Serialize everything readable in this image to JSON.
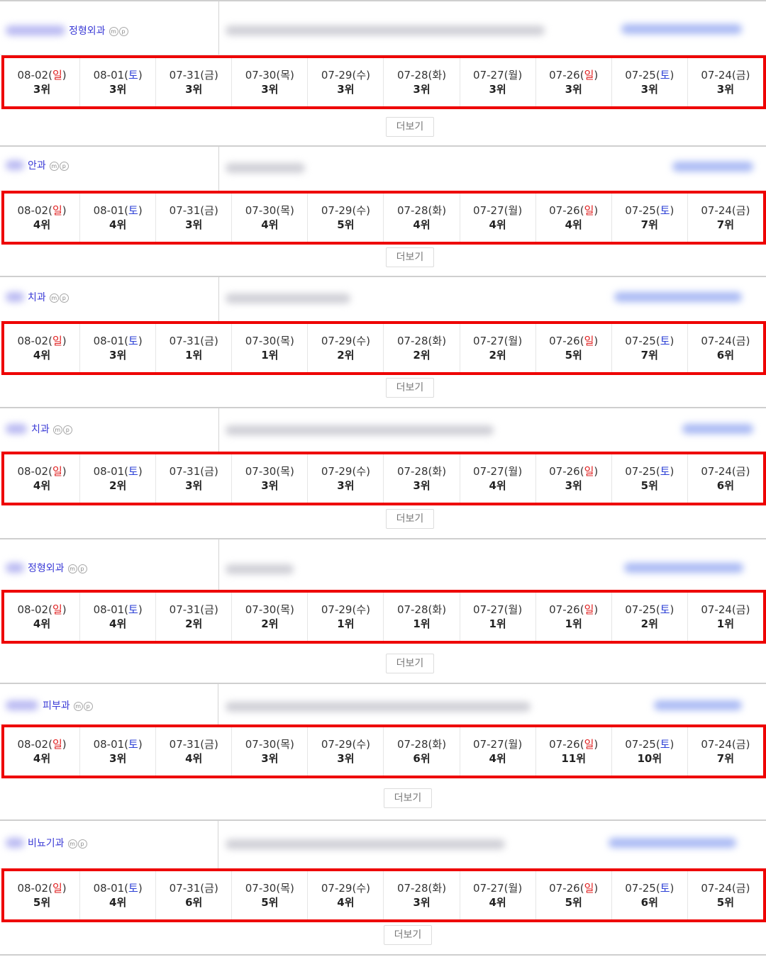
{
  "more_label": "더보기",
  "colors": {
    "highlight_border": "#ee0000",
    "sunday": "#e02020",
    "saturday": "#2b3fd6",
    "category": "#3b3bd6"
  },
  "icons": [
    "mobile-badge-icon",
    "pc-badge-icon"
  ],
  "badges": {
    "m": "m",
    "p": "p"
  },
  "sections": [
    {
      "category": "정형외과",
      "days": [
        {
          "date": "08-02",
          "wd": "일",
          "type": "sun",
          "rank": "3위"
        },
        {
          "date": "08-01",
          "wd": "토",
          "type": "sat",
          "rank": "3위"
        },
        {
          "date": "07-31",
          "wd": "금",
          "type": "wk",
          "rank": "3위"
        },
        {
          "date": "07-30",
          "wd": "목",
          "type": "wk",
          "rank": "3위"
        },
        {
          "date": "07-29",
          "wd": "수",
          "type": "wk",
          "rank": "3위"
        },
        {
          "date": "07-28",
          "wd": "화",
          "type": "wk",
          "rank": "3위"
        },
        {
          "date": "07-27",
          "wd": "월",
          "type": "wk",
          "rank": "3위"
        },
        {
          "date": "07-26",
          "wd": "일",
          "type": "sun",
          "rank": "3위"
        },
        {
          "date": "07-25",
          "wd": "토",
          "type": "sat",
          "rank": "3위"
        },
        {
          "date": "07-24",
          "wd": "금",
          "type": "wk",
          "rank": "3위"
        }
      ]
    },
    {
      "category": "안과",
      "days": [
        {
          "date": "08-02",
          "wd": "일",
          "type": "sun",
          "rank": "4위"
        },
        {
          "date": "08-01",
          "wd": "토",
          "type": "sat",
          "rank": "4위"
        },
        {
          "date": "07-31",
          "wd": "금",
          "type": "wk",
          "rank": "3위"
        },
        {
          "date": "07-30",
          "wd": "목",
          "type": "wk",
          "rank": "4위"
        },
        {
          "date": "07-29",
          "wd": "수",
          "type": "wk",
          "rank": "5위"
        },
        {
          "date": "07-28",
          "wd": "화",
          "type": "wk",
          "rank": "4위"
        },
        {
          "date": "07-27",
          "wd": "월",
          "type": "wk",
          "rank": "4위"
        },
        {
          "date": "07-26",
          "wd": "일",
          "type": "sun",
          "rank": "4위"
        },
        {
          "date": "07-25",
          "wd": "토",
          "type": "sat",
          "rank": "7위"
        },
        {
          "date": "07-24",
          "wd": "금",
          "type": "wk",
          "rank": "7위"
        }
      ]
    },
    {
      "category": "치과",
      "days": [
        {
          "date": "08-02",
          "wd": "일",
          "type": "sun",
          "rank": "4위"
        },
        {
          "date": "08-01",
          "wd": "토",
          "type": "sat",
          "rank": "3위"
        },
        {
          "date": "07-31",
          "wd": "금",
          "type": "wk",
          "rank": "1위"
        },
        {
          "date": "07-30",
          "wd": "목",
          "type": "wk",
          "rank": "1위"
        },
        {
          "date": "07-29",
          "wd": "수",
          "type": "wk",
          "rank": "2위"
        },
        {
          "date": "07-28",
          "wd": "화",
          "type": "wk",
          "rank": "2위"
        },
        {
          "date": "07-27",
          "wd": "월",
          "type": "wk",
          "rank": "2위"
        },
        {
          "date": "07-26",
          "wd": "일",
          "type": "sun",
          "rank": "5위"
        },
        {
          "date": "07-25",
          "wd": "토",
          "type": "sat",
          "rank": "7위"
        },
        {
          "date": "07-24",
          "wd": "금",
          "type": "wk",
          "rank": "6위"
        }
      ]
    },
    {
      "category": "치과",
      "days": [
        {
          "date": "08-02",
          "wd": "일",
          "type": "sun",
          "rank": "4위"
        },
        {
          "date": "08-01",
          "wd": "토",
          "type": "sat",
          "rank": "2위"
        },
        {
          "date": "07-31",
          "wd": "금",
          "type": "wk",
          "rank": "3위"
        },
        {
          "date": "07-30",
          "wd": "목",
          "type": "wk",
          "rank": "3위"
        },
        {
          "date": "07-29",
          "wd": "수",
          "type": "wk",
          "rank": "3위"
        },
        {
          "date": "07-28",
          "wd": "화",
          "type": "wk",
          "rank": "3위"
        },
        {
          "date": "07-27",
          "wd": "월",
          "type": "wk",
          "rank": "4위"
        },
        {
          "date": "07-26",
          "wd": "일",
          "type": "sun",
          "rank": "3위"
        },
        {
          "date": "07-25",
          "wd": "토",
          "type": "sat",
          "rank": "5위"
        },
        {
          "date": "07-24",
          "wd": "금",
          "type": "wk",
          "rank": "6위"
        }
      ]
    },
    {
      "category": "정형외과",
      "days": [
        {
          "date": "08-02",
          "wd": "일",
          "type": "sun",
          "rank": "4위"
        },
        {
          "date": "08-01",
          "wd": "토",
          "type": "sat",
          "rank": "4위"
        },
        {
          "date": "07-31",
          "wd": "금",
          "type": "wk",
          "rank": "2위"
        },
        {
          "date": "07-30",
          "wd": "목",
          "type": "wk",
          "rank": "2위"
        },
        {
          "date": "07-29",
          "wd": "수",
          "type": "wk",
          "rank": "1위"
        },
        {
          "date": "07-28",
          "wd": "화",
          "type": "wk",
          "rank": "1위"
        },
        {
          "date": "07-27",
          "wd": "월",
          "type": "wk",
          "rank": "1위"
        },
        {
          "date": "07-26",
          "wd": "일",
          "type": "sun",
          "rank": "1위"
        },
        {
          "date": "07-25",
          "wd": "토",
          "type": "sat",
          "rank": "2위"
        },
        {
          "date": "07-24",
          "wd": "금",
          "type": "wk",
          "rank": "1위"
        }
      ]
    },
    {
      "category": "피부과",
      "days": [
        {
          "date": "08-02",
          "wd": "일",
          "type": "sun",
          "rank": "4위"
        },
        {
          "date": "08-01",
          "wd": "토",
          "type": "sat",
          "rank": "3위"
        },
        {
          "date": "07-31",
          "wd": "금",
          "type": "wk",
          "rank": "4위"
        },
        {
          "date": "07-30",
          "wd": "목",
          "type": "wk",
          "rank": "3위"
        },
        {
          "date": "07-29",
          "wd": "수",
          "type": "wk",
          "rank": "3위"
        },
        {
          "date": "07-28",
          "wd": "화",
          "type": "wk",
          "rank": "6위"
        },
        {
          "date": "07-27",
          "wd": "월",
          "type": "wk",
          "rank": "4위"
        },
        {
          "date": "07-26",
          "wd": "일",
          "type": "sun",
          "rank": "11위"
        },
        {
          "date": "07-25",
          "wd": "토",
          "type": "sat",
          "rank": "10위"
        },
        {
          "date": "07-24",
          "wd": "금",
          "type": "wk",
          "rank": "7위"
        }
      ]
    },
    {
      "category": "비뇨기과",
      "days": [
        {
          "date": "08-02",
          "wd": "일",
          "type": "sun",
          "rank": "5위"
        },
        {
          "date": "08-01",
          "wd": "토",
          "type": "sat",
          "rank": "4위"
        },
        {
          "date": "07-31",
          "wd": "금",
          "type": "wk",
          "rank": "6위"
        },
        {
          "date": "07-30",
          "wd": "목",
          "type": "wk",
          "rank": "5위"
        },
        {
          "date": "07-29",
          "wd": "수",
          "type": "wk",
          "rank": "4위"
        },
        {
          "date": "07-28",
          "wd": "화",
          "type": "wk",
          "rank": "3위"
        },
        {
          "date": "07-27",
          "wd": "월",
          "type": "wk",
          "rank": "4위"
        },
        {
          "date": "07-26",
          "wd": "일",
          "type": "sun",
          "rank": "5위"
        },
        {
          "date": "07-25",
          "wd": "토",
          "type": "sat",
          "rank": "6위"
        },
        {
          "date": "07-24",
          "wd": "금",
          "type": "wk",
          "rank": "5위"
        }
      ]
    }
  ]
}
